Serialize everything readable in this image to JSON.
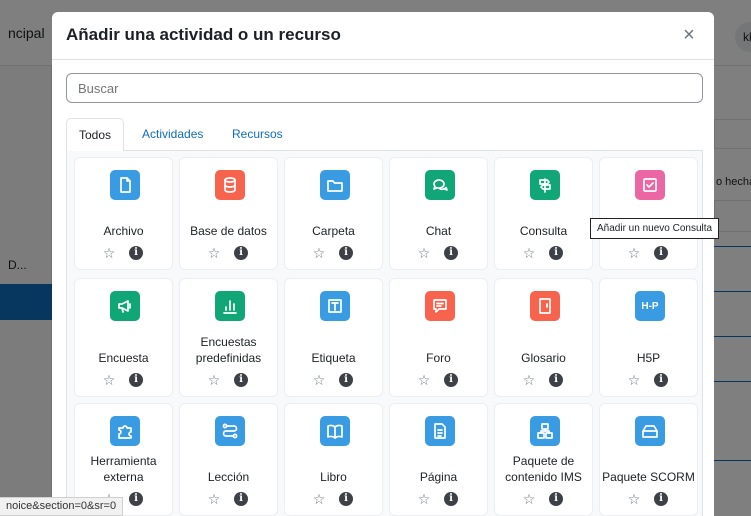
{
  "background": {
    "nav_left": "ncipal",
    "avatar": "kl",
    "drawer_text": "D...",
    "right_text": "o hecha"
  },
  "modal": {
    "title": "Añadir una actividad o un recurso",
    "close": "×",
    "search_placeholder": "Buscar",
    "tabs": [
      {
        "label": "Todos",
        "active": true
      },
      {
        "label": "Actividades",
        "active": false
      },
      {
        "label": "Recursos",
        "active": false
      }
    ],
    "cards": [
      {
        "name": "Archivo",
        "icon": "file-icon",
        "color": "#399be2"
      },
      {
        "name": "Base de datos",
        "icon": "database-icon",
        "color": "#f7634d"
      },
      {
        "name": "Carpeta",
        "icon": "folder-icon",
        "color": "#399be2"
      },
      {
        "name": "Chat",
        "icon": "chat-icon",
        "color": "#11a676"
      },
      {
        "name": "Consulta",
        "icon": "signpost-icon",
        "color": "#11a676"
      },
      {
        "name": "",
        "icon": "checklist-icon",
        "color": "#eb66a2"
      },
      {
        "name": "Encuesta",
        "icon": "megaphone-icon",
        "color": "#11a676"
      },
      {
        "name": "Encuestas predefinidas",
        "icon": "bar-chart-icon",
        "color": "#11a676"
      },
      {
        "name": "Etiqueta",
        "icon": "text-label-icon",
        "color": "#399be2"
      },
      {
        "name": "Foro",
        "icon": "forum-icon",
        "color": "#f7634d"
      },
      {
        "name": "Glosario",
        "icon": "glossary-icon",
        "color": "#f7634d"
      },
      {
        "name": "H5P",
        "icon": "h5p-icon",
        "color": "#399be2"
      },
      {
        "name": "Herramienta externa",
        "icon": "puzzle-icon",
        "color": "#399be2"
      },
      {
        "name": "Lección",
        "icon": "lesson-icon",
        "color": "#399be2"
      },
      {
        "name": "Libro",
        "icon": "book-icon",
        "color": "#399be2"
      },
      {
        "name": "Página",
        "icon": "page-icon",
        "color": "#399be2"
      },
      {
        "name": "Paquete de contenido IMS",
        "icon": "package-icon",
        "color": "#399be2"
      },
      {
        "name": "Paquete SCORM",
        "icon": "scorm-icon",
        "color": "#399be2"
      }
    ],
    "star_glyph": "☆",
    "info_glyph": "i",
    "h5p_text": "H-P"
  },
  "tooltip": "Añadir un nuevo Consulta",
  "status_url": "noice&section=0&sr=0"
}
